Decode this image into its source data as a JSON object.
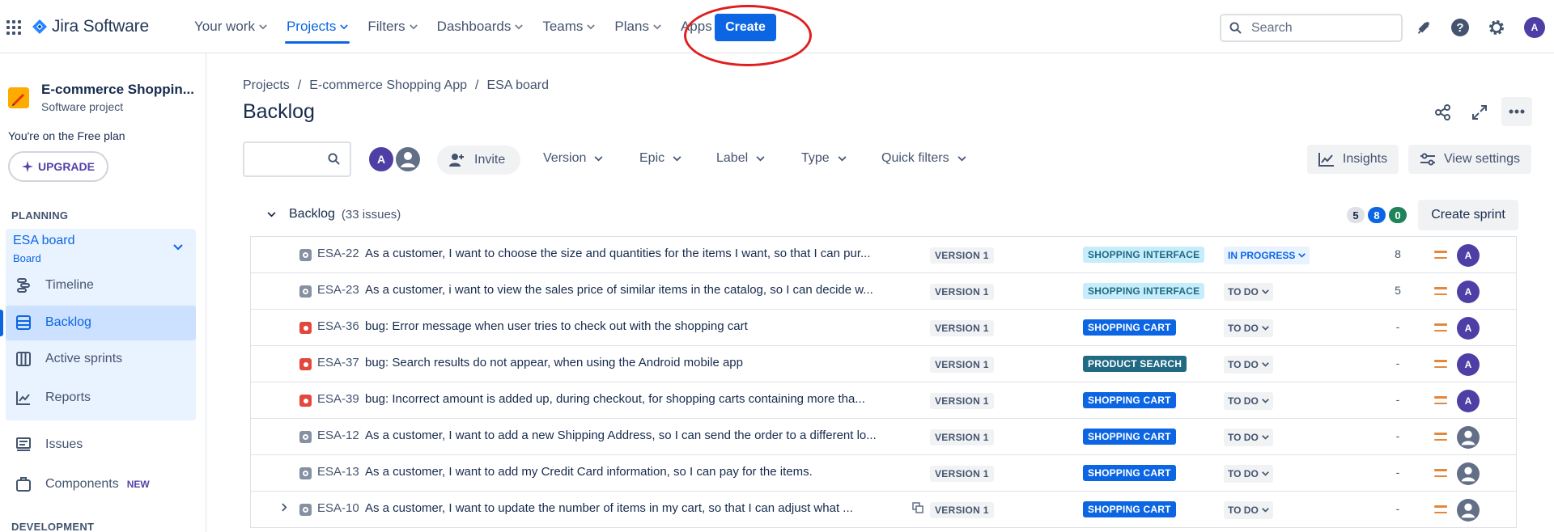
{
  "topnav": {
    "product": "Jira Software",
    "items": [
      {
        "label": "Your work",
        "active": false
      },
      {
        "label": "Projects",
        "active": true
      },
      {
        "label": "Filters",
        "active": false
      },
      {
        "label": "Dashboards",
        "active": false
      },
      {
        "label": "Teams",
        "active": false
      },
      {
        "label": "Plans",
        "active": false
      },
      {
        "label": "Apps",
        "active": false
      }
    ],
    "create_label": "Create",
    "search_placeholder": "Search",
    "user_initial": "A",
    "icons": [
      "grid-icon",
      "jira-logo-icon",
      "search-icon",
      "notifications-icon",
      "help-icon",
      "settings-icon"
    ]
  },
  "sidebar": {
    "project_name": "E-commerce Shoppin...",
    "project_type": "Software project",
    "plan_text": "You're on the Free plan",
    "upgrade_label": "UPGRADE",
    "planning_title": "PLANNING",
    "board_name": "ESA board",
    "board_sub": "Board",
    "items": [
      {
        "label": "Timeline",
        "icon": "timeline-icon"
      },
      {
        "label": "Backlog",
        "icon": "backlog-icon",
        "selected": true
      },
      {
        "label": "Active sprints",
        "icon": "columns-icon"
      },
      {
        "label": "Reports",
        "icon": "chart-icon"
      },
      {
        "label": "Issues",
        "icon": "issues-icon"
      },
      {
        "label": "Components",
        "icon": "component-icon",
        "badge": "NEW"
      }
    ],
    "development_title": "DEVELOPMENT"
  },
  "main": {
    "breadcrumb": [
      "Projects",
      "/",
      "E-commerce Shopping App",
      "/",
      "ESA board"
    ],
    "title": "Backlog",
    "filters": {
      "avatar_initial": "A",
      "invite_label": "Invite",
      "dropdowns": [
        "Version",
        "Epic",
        "Label",
        "Type",
        "Quick filters"
      ],
      "insights_label": "Insights",
      "view_settings_label": "View settings"
    },
    "backlog": {
      "title": "Backlog",
      "count": "(33 issues)",
      "todo_points": "5",
      "inprogress_points": "8",
      "done_points": "0",
      "create_sprint_label": "Create sprint"
    },
    "issues": [
      {
        "key": "ESA-22",
        "type": "story",
        "summary": "As a customer, I want to choose the size and quantities for the items I want, so that I can pur...",
        "version": "VERSION 1",
        "epic": "SHOPPING INTERFACE",
        "epic_style": "light-blue",
        "status": "IN PROGRESS",
        "status_style": "inprogress",
        "estimate": "8",
        "assignee": "A"
      },
      {
        "key": "ESA-23",
        "type": "story",
        "summary": "As a customer, i want to view the sales price of similar items in the catalog, so I can decide w...",
        "version": "VERSION 1",
        "epic": "SHOPPING INTERFACE",
        "epic_style": "light-blue",
        "status": "TO DO",
        "status_style": "todo",
        "estimate": "5",
        "assignee": "A"
      },
      {
        "key": "ESA-36",
        "type": "bug",
        "summary": "bug: Error message when user tries to check out with the shopping cart",
        "version": "VERSION 1",
        "epic": "SHOPPING CART",
        "epic_style": "blue",
        "status": "TO DO",
        "status_style": "todo",
        "estimate": "-",
        "assignee": "A"
      },
      {
        "key": "ESA-37",
        "type": "bug",
        "summary": "bug: Search results do not appear, when using the Android mobile app",
        "version": "VERSION 1",
        "epic": "PRODUCT SEARCH",
        "epic_style": "teal",
        "status": "TO DO",
        "status_style": "todo",
        "estimate": "-",
        "assignee": "A"
      },
      {
        "key": "ESA-39",
        "type": "bug",
        "summary": "bug: Incorrect amount is added up, during checkout, for shopping carts containing more tha...",
        "version": "VERSION 1",
        "epic": "SHOPPING CART",
        "epic_style": "blue",
        "status": "TO DO",
        "status_style": "todo",
        "estimate": "-",
        "assignee": "A"
      },
      {
        "key": "ESA-12",
        "type": "story",
        "summary": "As a customer, I want to add a new Shipping Address, so I can send the order to a different lo...",
        "version": "VERSION 1",
        "epic": "SHOPPING CART",
        "epic_style": "blue",
        "status": "TO DO",
        "status_style": "todo",
        "estimate": "-",
        "assignee": ""
      },
      {
        "key": "ESA-13",
        "type": "story",
        "summary": "As a customer, I want to add my Credit Card information, so I can pay for the items.",
        "version": "VERSION 1",
        "epic": "SHOPPING CART",
        "epic_style": "blue",
        "status": "TO DO",
        "status_style": "todo",
        "estimate": "-",
        "assignee": ""
      },
      {
        "key": "ESA-10",
        "type": "story",
        "summary": "As a customer, I want to update the number of items in my cart, so that I can adjust what ...",
        "version": "VERSION 1",
        "epic": "SHOPPING CART",
        "epic_style": "blue",
        "status": "TO DO",
        "status_style": "todo",
        "estimate": "-",
        "assignee": "",
        "has_children": true
      }
    ],
    "colors": {
      "accent": "#0c66e4",
      "epic_light_blue_bg": "#c6edfb",
      "epic_light_blue_fg": "#206a83",
      "epic_blue_bg": "#0c66e4",
      "epic_teal_bg": "#206a83",
      "annotation_red": "#e01e1e"
    }
  }
}
